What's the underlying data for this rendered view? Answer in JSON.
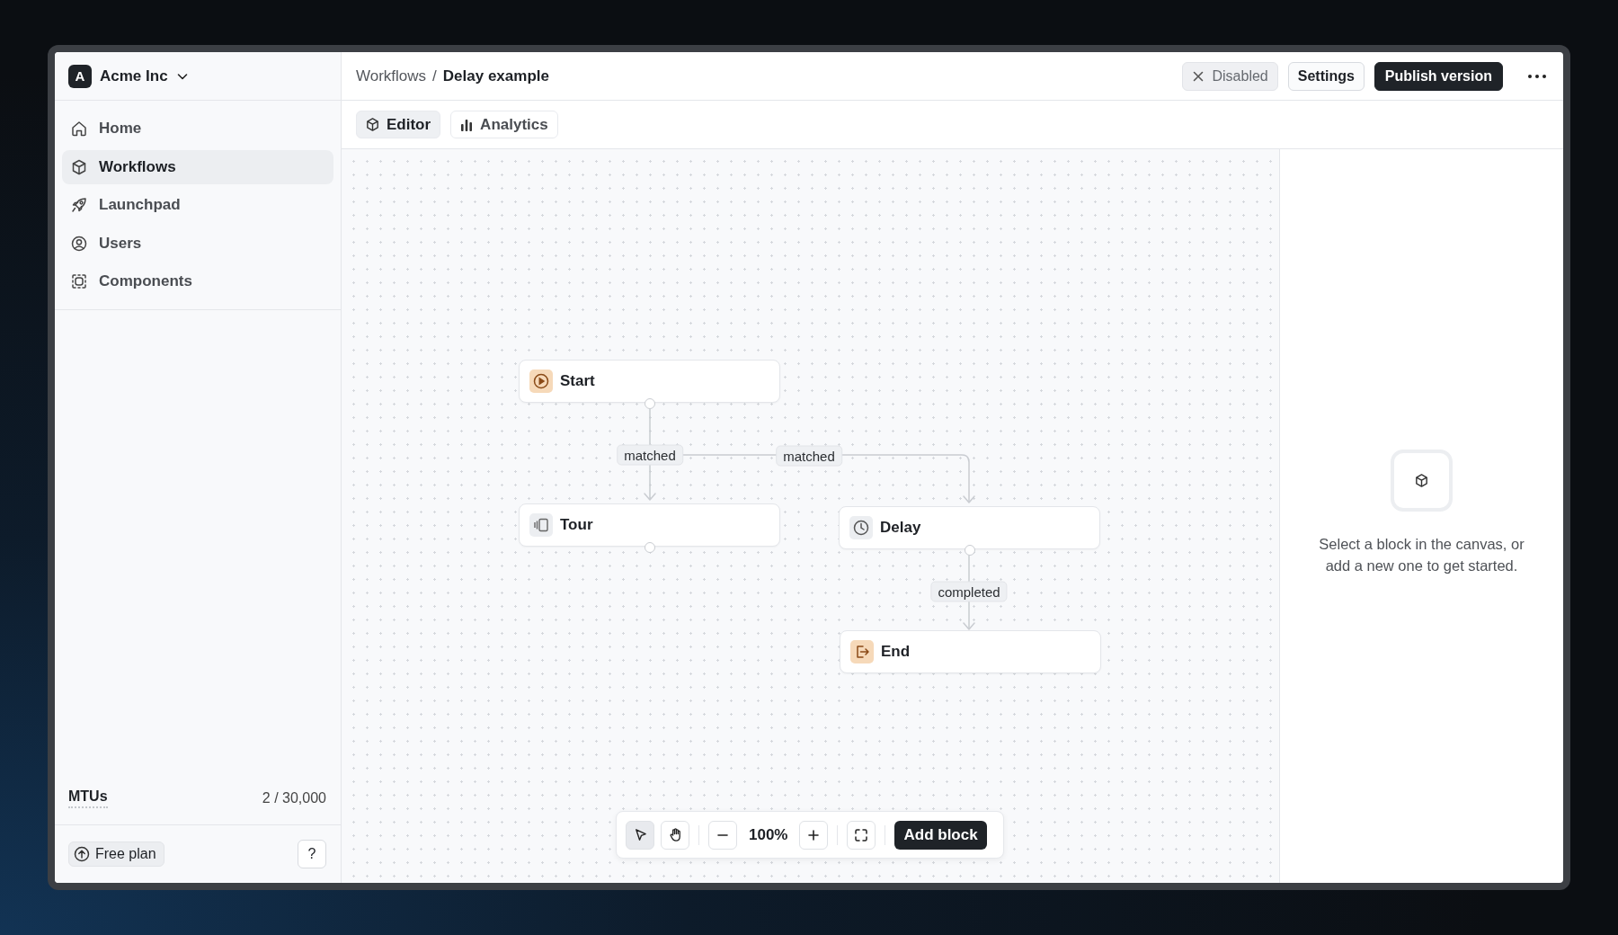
{
  "workspace": {
    "initial": "A",
    "name": "Acme Inc"
  },
  "sidebar": {
    "items": [
      {
        "label": "Home",
        "selected": false
      },
      {
        "label": "Workflows",
        "selected": true
      },
      {
        "label": "Launchpad",
        "selected": false
      },
      {
        "label": "Users",
        "selected": false
      },
      {
        "label": "Components",
        "selected": false
      }
    ]
  },
  "usage": {
    "label": "MTUs",
    "value": "2 / 30,000"
  },
  "plan": {
    "label": "Free plan"
  },
  "help": {
    "label": "?"
  },
  "breadcrumb": {
    "parent": "Workflows",
    "separator": "/",
    "current": "Delay example"
  },
  "actions": {
    "status": "Disabled",
    "settings": "Settings",
    "publish": "Publish version"
  },
  "tabs": [
    {
      "label": "Editor",
      "selected": true
    },
    {
      "label": "Analytics",
      "selected": false
    }
  ],
  "canvas": {
    "nodes": [
      {
        "label": "Start",
        "kind": "start"
      },
      {
        "label": "Tour",
        "kind": "tour"
      },
      {
        "label": "Delay",
        "kind": "delay"
      },
      {
        "label": "End",
        "kind": "end"
      }
    ],
    "edges": [
      {
        "label": "matched"
      },
      {
        "label": "matched"
      },
      {
        "label": "completed"
      }
    ]
  },
  "toolbar": {
    "tools": [
      {
        "kind": "select",
        "selected": true
      },
      {
        "kind": "pan",
        "selected": false
      }
    ],
    "zoom": "100%",
    "add": "Add block"
  },
  "panel": {
    "message": "Select a block in the canvas, or add a new one to get started."
  }
}
